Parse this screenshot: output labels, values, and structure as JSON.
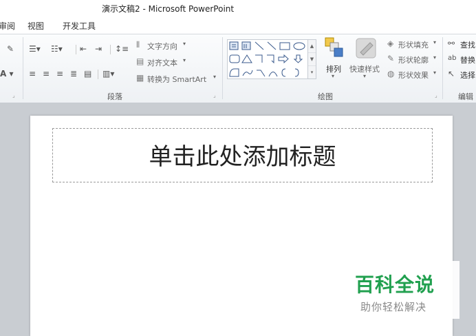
{
  "window": {
    "title": "演示文稿2 - Microsoft PowerPoint"
  },
  "tabs": [
    {
      "label": "审阅"
    },
    {
      "label": "视图"
    },
    {
      "label": "开发工具"
    }
  ],
  "ribbon": {
    "paragraph": {
      "label": "段落",
      "text_direction": "文字方向",
      "align_text": "对齐文本",
      "convert_smartart": "转换为 SmartArt"
    },
    "drawing": {
      "label": "绘图",
      "arrange": "排列",
      "quick_styles": "快速样式",
      "shape_fill": "形状填充",
      "shape_outline": "形状轮廓",
      "shape_effects": "形状效果"
    },
    "editing": {
      "label": "编辑",
      "find": "查找",
      "replace": "替换",
      "select": "选择"
    }
  },
  "slide": {
    "title_placeholder": "单击此处添加标题"
  },
  "watermark": {
    "main": "百科全说",
    "sub": "助你轻松解决"
  }
}
